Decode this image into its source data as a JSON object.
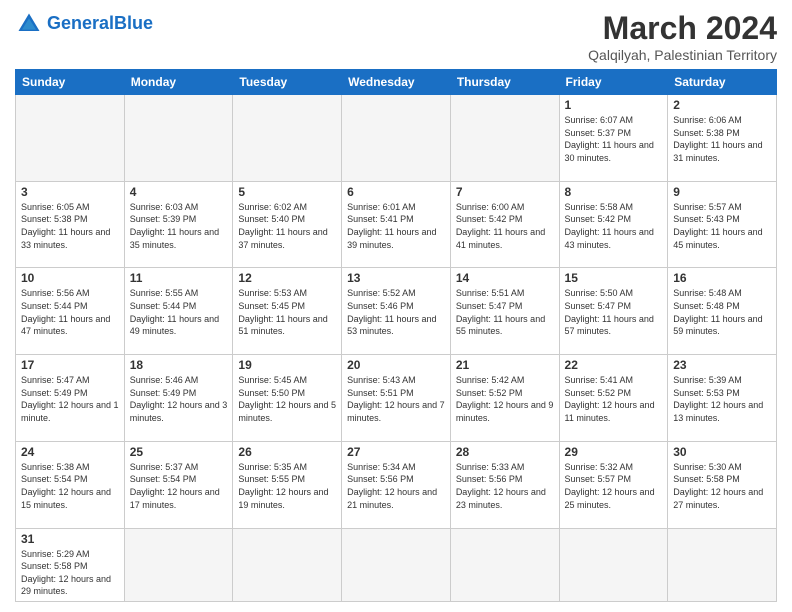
{
  "header": {
    "logo_general": "General",
    "logo_blue": "Blue",
    "main_title": "March 2024",
    "sub_title": "Qalqilyah, Palestinian Territory"
  },
  "days_of_week": [
    "Sunday",
    "Monday",
    "Tuesday",
    "Wednesday",
    "Thursday",
    "Friday",
    "Saturday"
  ],
  "weeks": [
    [
      {
        "day": "",
        "info": "",
        "empty": true
      },
      {
        "day": "",
        "info": "",
        "empty": true
      },
      {
        "day": "",
        "info": "",
        "empty": true
      },
      {
        "day": "",
        "info": "",
        "empty": true
      },
      {
        "day": "",
        "info": "",
        "empty": true
      },
      {
        "day": "1",
        "info": "Sunrise: 6:07 AM\nSunset: 5:37 PM\nDaylight: 11 hours\nand 30 minutes."
      },
      {
        "day": "2",
        "info": "Sunrise: 6:06 AM\nSunset: 5:38 PM\nDaylight: 11 hours\nand 31 minutes."
      }
    ],
    [
      {
        "day": "3",
        "info": "Sunrise: 6:05 AM\nSunset: 5:38 PM\nDaylight: 11 hours\nand 33 minutes."
      },
      {
        "day": "4",
        "info": "Sunrise: 6:03 AM\nSunset: 5:39 PM\nDaylight: 11 hours\nand 35 minutes."
      },
      {
        "day": "5",
        "info": "Sunrise: 6:02 AM\nSunset: 5:40 PM\nDaylight: 11 hours\nand 37 minutes."
      },
      {
        "day": "6",
        "info": "Sunrise: 6:01 AM\nSunset: 5:41 PM\nDaylight: 11 hours\nand 39 minutes."
      },
      {
        "day": "7",
        "info": "Sunrise: 6:00 AM\nSunset: 5:42 PM\nDaylight: 11 hours\nand 41 minutes."
      },
      {
        "day": "8",
        "info": "Sunrise: 5:58 AM\nSunset: 5:42 PM\nDaylight: 11 hours\nand 43 minutes."
      },
      {
        "day": "9",
        "info": "Sunrise: 5:57 AM\nSunset: 5:43 PM\nDaylight: 11 hours\nand 45 minutes."
      }
    ],
    [
      {
        "day": "10",
        "info": "Sunrise: 5:56 AM\nSunset: 5:44 PM\nDaylight: 11 hours\nand 47 minutes."
      },
      {
        "day": "11",
        "info": "Sunrise: 5:55 AM\nSunset: 5:44 PM\nDaylight: 11 hours\nand 49 minutes."
      },
      {
        "day": "12",
        "info": "Sunrise: 5:53 AM\nSunset: 5:45 PM\nDaylight: 11 hours\nand 51 minutes."
      },
      {
        "day": "13",
        "info": "Sunrise: 5:52 AM\nSunset: 5:46 PM\nDaylight: 11 hours\nand 53 minutes."
      },
      {
        "day": "14",
        "info": "Sunrise: 5:51 AM\nSunset: 5:47 PM\nDaylight: 11 hours\nand 55 minutes."
      },
      {
        "day": "15",
        "info": "Sunrise: 5:50 AM\nSunset: 5:47 PM\nDaylight: 11 hours\nand 57 minutes."
      },
      {
        "day": "16",
        "info": "Sunrise: 5:48 AM\nSunset: 5:48 PM\nDaylight: 11 hours\nand 59 minutes."
      }
    ],
    [
      {
        "day": "17",
        "info": "Sunrise: 5:47 AM\nSunset: 5:49 PM\nDaylight: 12 hours\nand 1 minute."
      },
      {
        "day": "18",
        "info": "Sunrise: 5:46 AM\nSunset: 5:49 PM\nDaylight: 12 hours\nand 3 minutes."
      },
      {
        "day": "19",
        "info": "Sunrise: 5:45 AM\nSunset: 5:50 PM\nDaylight: 12 hours\nand 5 minutes."
      },
      {
        "day": "20",
        "info": "Sunrise: 5:43 AM\nSunset: 5:51 PM\nDaylight: 12 hours\nand 7 minutes."
      },
      {
        "day": "21",
        "info": "Sunrise: 5:42 AM\nSunset: 5:52 PM\nDaylight: 12 hours\nand 9 minutes."
      },
      {
        "day": "22",
        "info": "Sunrise: 5:41 AM\nSunset: 5:52 PM\nDaylight: 12 hours\nand 11 minutes."
      },
      {
        "day": "23",
        "info": "Sunrise: 5:39 AM\nSunset: 5:53 PM\nDaylight: 12 hours\nand 13 minutes."
      }
    ],
    [
      {
        "day": "24",
        "info": "Sunrise: 5:38 AM\nSunset: 5:54 PM\nDaylight: 12 hours\nand 15 minutes."
      },
      {
        "day": "25",
        "info": "Sunrise: 5:37 AM\nSunset: 5:54 PM\nDaylight: 12 hours\nand 17 minutes."
      },
      {
        "day": "26",
        "info": "Sunrise: 5:35 AM\nSunset: 5:55 PM\nDaylight: 12 hours\nand 19 minutes."
      },
      {
        "day": "27",
        "info": "Sunrise: 5:34 AM\nSunset: 5:56 PM\nDaylight: 12 hours\nand 21 minutes."
      },
      {
        "day": "28",
        "info": "Sunrise: 5:33 AM\nSunset: 5:56 PM\nDaylight: 12 hours\nand 23 minutes."
      },
      {
        "day": "29",
        "info": "Sunrise: 5:32 AM\nSunset: 5:57 PM\nDaylight: 12 hours\nand 25 minutes."
      },
      {
        "day": "30",
        "info": "Sunrise: 5:30 AM\nSunset: 5:58 PM\nDaylight: 12 hours\nand 27 minutes."
      }
    ],
    [
      {
        "day": "31",
        "info": "Sunrise: 5:29 AM\nSunset: 5:58 PM\nDaylight: 12 hours\nand 29 minutes."
      },
      {
        "day": "",
        "info": "",
        "empty": true
      },
      {
        "day": "",
        "info": "",
        "empty": true
      },
      {
        "day": "",
        "info": "",
        "empty": true
      },
      {
        "day": "",
        "info": "",
        "empty": true
      },
      {
        "day": "",
        "info": "",
        "empty": true
      },
      {
        "day": "",
        "info": "",
        "empty": true
      }
    ]
  ]
}
